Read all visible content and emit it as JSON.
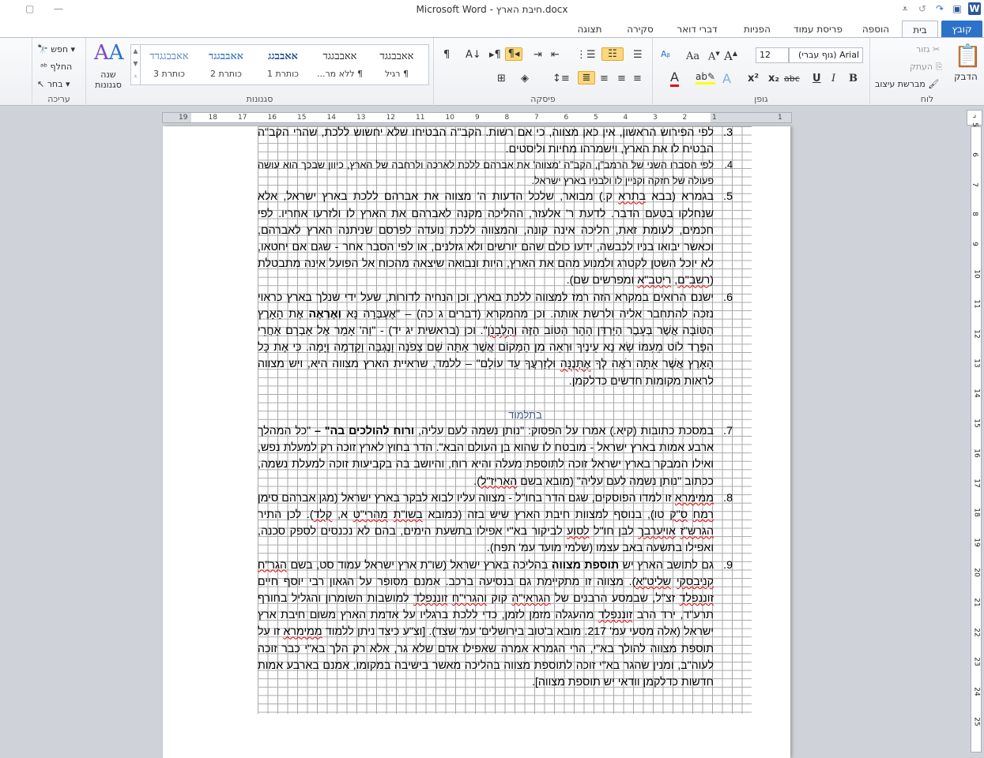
{
  "window": {
    "title": "Microsoft Word - חיבת הארץ.docx"
  },
  "tabs": [
    {
      "label": "קובץ"
    },
    {
      "label": "בית"
    },
    {
      "label": "הוספה"
    },
    {
      "label": "פריסת עמוד"
    },
    {
      "label": "הפניות"
    },
    {
      "label": "דברי דואר"
    },
    {
      "label": "סקירה"
    },
    {
      "label": "תצוגה"
    }
  ],
  "ribbon": {
    "clipboard": {
      "label": "לוח",
      "paste": "הדבק",
      "cut": "גזור",
      "copy": "העתק",
      "format_painter": "מברשת עיצוב"
    },
    "font": {
      "label": "גופן",
      "font_name": "Arial (גוף עברי)",
      "font_size": "12"
    },
    "paragraph": {
      "label": "פיסקה"
    },
    "styles": {
      "label": "סגנונות",
      "change_styles": "שנה סגנונות",
      "items": [
        {
          "sample": "אאבבגגד",
          "name": "¶ רגיל"
        },
        {
          "sample": "אאבבגגד",
          "name": "¶ ללא מר..."
        },
        {
          "sample": "אאבבגג",
          "name": "כותרת 1"
        },
        {
          "sample": "אאבבגגד",
          "name": "כותרת 2"
        },
        {
          "sample": "אאבבגגדד",
          "name": "כותרת 3"
        }
      ]
    },
    "editing": {
      "label": "עריכה",
      "find": "חפש",
      "replace": "החלף",
      "select": "בחר"
    },
    "colors": {
      "file_tab": "#2b72c8",
      "highlight": "#fbd87a",
      "font_color": "#e01010",
      "highlight_color": "#ffff00"
    }
  },
  "ruler": {
    "ticks": [
      "19",
      "18",
      "17",
      "16",
      "15",
      "14",
      "13",
      "12",
      "11",
      "10",
      "9",
      "8",
      "7",
      "6",
      "5",
      "4",
      "3",
      "2",
      "1",
      "1"
    ]
  },
  "vruler": {
    "ticks": [
      "5",
      "6",
      "7",
      "8",
      "9",
      "10",
      "11",
      "12",
      "13",
      "14",
      "15",
      "16",
      "17",
      "18",
      "19",
      "20",
      "21",
      "22",
      "23",
      "24",
      "25"
    ]
  },
  "document": {
    "paragraphs": [
      {
        "num": "3.",
        "segments": [
          {
            "t": "לפי הפירוש הראשון, אין כאן מצווה, כי אם רשות. הקב\"ה הבטיחו שלא יחשוש ללכת, שהרי הקב\"ה הבטיח לו את הארץ, וישמרהו מחיות וליסטים."
          }
        ]
      },
      {
        "num": "4.",
        "small": true,
        "segments": [
          {
            "t": "לפי הסברו השני של הרמב\"ן, הקב\"ה 'מצווה' את אברהם ללכת לארכה ולרחבה של הארץ, כיוון שבכך הוא עושה פעולה של חזקה וקניין לו ולבניו בארץ ישראל."
          }
        ]
      },
      {
        "num": "5.",
        "segments": [
          {
            "t": "בגמרא (בבא "
          },
          {
            "t": "בתרא",
            "sq": true
          },
          {
            "t": " ק.) מבואר, שלכל הדעות ה' מצווה את אברהם ללכת בארץ ישראל, אלא שנחלקו בטעם הדבר. לדעת ר' אלעזר, ההליכה מקנה לאברהם את הארץ לו ולזרעו אחריו. לפי חכמים, לעומת זאת, הליכה אינה קונה, והמצווה ללכת נועדה לפרסם שניתנה הארץ לאברהם, וכאשר יבואו בניו לכבשה, ידעו כולם שהם יורשים ולא גזלנים, או לפי הסבר אחר - שגם אם יחטאו, לא יוכל השטן לקטרג ולמנוע מהם את הארץ, היות ונבואה שיצאה מהכוח אל הפועל אינה מתבטלת ("
          },
          {
            "t": "רשב\"ם",
            "sq": true
          },
          {
            "t": ", "
          },
          {
            "t": "ריטב\"א",
            "sq": true
          },
          {
            "t": " ומפרשים שם)."
          }
        ]
      },
      {
        "num": "6.",
        "segments": [
          {
            "t": "ישנם הרואים במקרא הזה רמז למצווה ללכת בארץ, וכן הנחיה לדורות, שעל ידי שנלך בארץ כראוי נזכה להתחבר אליה ולרשת אותה. וכן מהמקרא (דברים ג כה) – \"אֶעְבְּרָה נָּא "
          },
          {
            "t": "וְאֶרְאֶה",
            "b": true
          },
          {
            "t": " אֶת הָאָרֶץ הַטּוֹבָה אֲשֶׁר בְּעֵבֶר הַיַּרְדֵּן הָהָר הַטּוֹב הַזֶּה "
          },
          {
            "t": "וְהַלְּבָנֹן",
            "sq": true
          },
          {
            "t": "\". וכן (בראשית יג יד) - \"וַה' אָמַר אֶל אַבְרָם אַחֲרֵי הִפָּרֶד לוֹט מֵעִמּוֹ שָׂא נָא עֵינֶיךָ וּרְאֵה מִן הַמָּקוֹם אֲשֶׁר אַתָּה שָׁם צָפֹנָה וָנֶגְבָּה וָקֵדְמָה וָיָמָּה. כִּי אֶת כָּל הָאָרֶץ אֲשֶׁר אַתָּה רֹאֶה לְךָ "
          },
          {
            "t": "אֶתְּנֶנָּה",
            "sq": true
          },
          {
            "t": " וּלְזַרְעֲךָ עַד עוֹלָם\" – ללמד, שראיית הארץ מצווה היא, ויש מצווה לראות מקומות חדשים כדלקמן."
          }
        ]
      }
    ],
    "heading": "בתלמוד",
    "paragraphs2": [
      {
        "num": "7.",
        "segments": [
          {
            "t": "במסכת כתובות (קיא.) אמרו על הפסוק: \"נותן נשמה לעם עליה, "
          },
          {
            "t": "ורוח להולכים בה\" –",
            "b": true
          },
          {
            "t": " \"כל המהלך ארבע אמות בארץ ישראל - מובטח לו שהוא בן העולם הבא\". הדר בחוץ לארץ זוכה רק למעלת נפש, ואילו המבקר בארץ ישראל זוכה לתוספת מעלה והיא רוח, והיושב בה בקביעות זוכה למעלת נשמה, ככתוב \"נותן נשמה לעם עליה\" (מובא בשם "
          },
          {
            "t": "האריז\"ל",
            "sq": true
          },
          {
            "t": ")."
          }
        ]
      },
      {
        "num": "8.",
        "segments": [
          {
            "t": "ממימרא",
            "sq": true
          },
          {
            "t": " זו למדו הפוסקים, שגם הדר בחו\"ל - מצווה עליו לבוא לבקר בארץ ישראל (מגן אברהם סימן "
          },
          {
            "t": "רמח",
            "sq": true
          },
          {
            "t": " "
          },
          {
            "t": "ס\"ק",
            "sq": true
          },
          {
            "t": " טו), בנוסף למצוות חיבת הארץ שיש בזה (כמובא "
          },
          {
            "t": "בשו\"ת",
            "sq": true
          },
          {
            "t": " "
          },
          {
            "t": "מהרי\"ט",
            "sq": true
          },
          {
            "t": " א, "
          },
          {
            "t": "קלד",
            "sq": true
          },
          {
            "t": "). לכן התיר "
          },
          {
            "t": "הגרש\"ז",
            "sq": true
          },
          {
            "t": " "
          },
          {
            "t": "אויערבך",
            "sq": true
          },
          {
            "t": " לבן חו\"ל "
          },
          {
            "t": "לסוע",
            "sq": true
          },
          {
            "t": " לביקור בא\"י אפילו בתשעת הימים, בהם לא נכנסים לספק סכנה, ואפילו בתשעה באב עצמו (שלמי מועד עמ' תפח)."
          }
        ]
      },
      {
        "num": "9.",
        "segments": [
          {
            "t": "גם לתושב הארץ יש "
          },
          {
            "t": "תוספת מצווה",
            "b": true
          },
          {
            "t": " בהליכה בארץ ישראל (שו\"ת ארץ ישראל עמוד סט, בשם "
          },
          {
            "t": "הגר\"ח",
            "sq": true
          },
          {
            "t": " "
          },
          {
            "t": "קניבסקי",
            "sq": true
          },
          {
            "t": " "
          },
          {
            "t": "שליט\"א",
            "sq": true
          },
          {
            "t": "). מצווה זו מתקיימת גם בנסיעה ברכב. אמנם מסופר על הגאון רבי יוסף חיים "
          },
          {
            "t": "זוננפלד",
            "sq": true
          },
          {
            "t": " זצ\"ל, שבמסע הרבנים של "
          },
          {
            "t": "הגראי\"ה",
            "sq": true
          },
          {
            "t": " קוק "
          },
          {
            "t": "והגרי\"ח",
            "sq": true
          },
          {
            "t": " "
          },
          {
            "t": "זוננפלד",
            "sq": true
          },
          {
            "t": " למושבות השומרון והגליל בחורף תרע\"ד, ירד הרב "
          },
          {
            "t": "זוננפלד",
            "sq": true
          },
          {
            "t": " מהעגלה מזמן לזמן, כדי ללכת ברגליו על אדמת הארץ משום חיבת ארץ ישראל (אלה מסעי עמ' 217. מובא ב'טוב בירושלים' עמ' שצד). [וצ\"ע כיצד ניתן ללמוד "
          },
          {
            "t": "ממימרא",
            "sq": true
          },
          {
            "t": " זו על תוספת מצווה להולך בא\"י, הרי הגמרא אמרה שאפילו אדם שלא גר, אלא רק הלך בא\"י כבר זוכה לעוה\"ב, ומנין שהגר בא\"י זוכה לתוספת מצווה בהליכה מאשר בישיבה במקומו, אמנם בארבע אמות חדשות כדלקמן וודאי יש תוספת מצווה]."
          }
        ]
      }
    ]
  }
}
